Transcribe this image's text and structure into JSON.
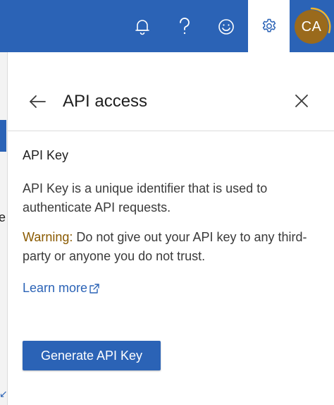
{
  "header": {
    "icons": {
      "notifications": "bell-icon",
      "help": "question-icon",
      "feedback": "smile-icon",
      "settings": "gear-icon"
    },
    "avatar_initials": "CA",
    "colors": {
      "bar": "#2b63b6",
      "avatar": "#9a6a1c",
      "ring": "#f0b429"
    }
  },
  "panel": {
    "title": "API access",
    "section_title": "API Key",
    "description": "API Key is a unique identifier that is used to authenticate API requests.",
    "warning_label": "Warning:",
    "warning_text": " Do not give out your API key to any third-party or anyone you do not trust.",
    "learn_more": "Learn more",
    "generate_button": "Generate API Key"
  },
  "background": {
    "partial_text": "e"
  }
}
